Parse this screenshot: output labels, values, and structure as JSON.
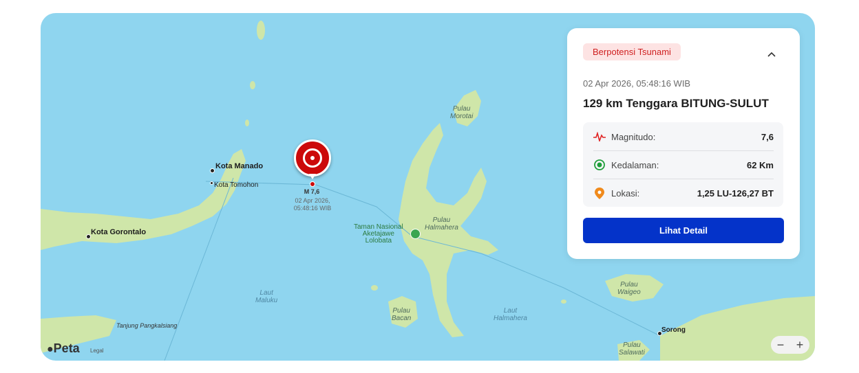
{
  "map": {
    "labels": {
      "kota_manado": "Kota Manado",
      "kota_tomohon": "Kota Tomohon",
      "kota_gorontalo": "Kota Gorontalo",
      "tanjung": "Tanjung Pangkalsiang",
      "pulau_morotai": "Pulau\nMorotai",
      "pulau_halmahera": "Pulau\nHalmahera",
      "taman_nasional": "Taman Nasional\nAketajawe\nLolobata",
      "laut_maluku": "Laut\nMaluku",
      "pulau_bacan": "Pulau\nBacan",
      "laut_halmahera": "Laut\nHalmahera",
      "pulau_waigeo": "Pulau\nWaigeo",
      "sorong": "Sorong",
      "pulau_salawati": "Pulau\nSalawati"
    },
    "epicenter": {
      "magnitude_label": "M 7,6",
      "time_label": "02 Apr 2026,\n05:48:16 WIB",
      "icon": "target-icon"
    },
    "attribution": {
      "brand": "Peta",
      "legal": "Legal",
      "icon": "apple-icon"
    },
    "zoom": {
      "out": "−",
      "in": "+"
    }
  },
  "card": {
    "badge": "Berpotensi Tsunami",
    "timestamp": "02 Apr 2026, 05:48:16 WIB",
    "title": "129 km Tenggara BITUNG-SULUT",
    "rows": [
      {
        "label": "Magnitudo:",
        "value": "7,6",
        "icon": "pulse-icon",
        "color": "#e02424"
      },
      {
        "label": "Kedalaman:",
        "value": "62 Km",
        "icon": "target-ring-icon",
        "color": "#1f9e3a"
      },
      {
        "label": "Lokasi:",
        "value": "1,25 LU-126,27 BT",
        "icon": "location-pin-icon",
        "color": "#f08a1c"
      }
    ],
    "button": "Lihat Detail"
  },
  "colors": {
    "sea": "#8fd5ef",
    "land": "#cfe6a9",
    "accent": "#0433c9",
    "alert": "#cc0a0a"
  }
}
